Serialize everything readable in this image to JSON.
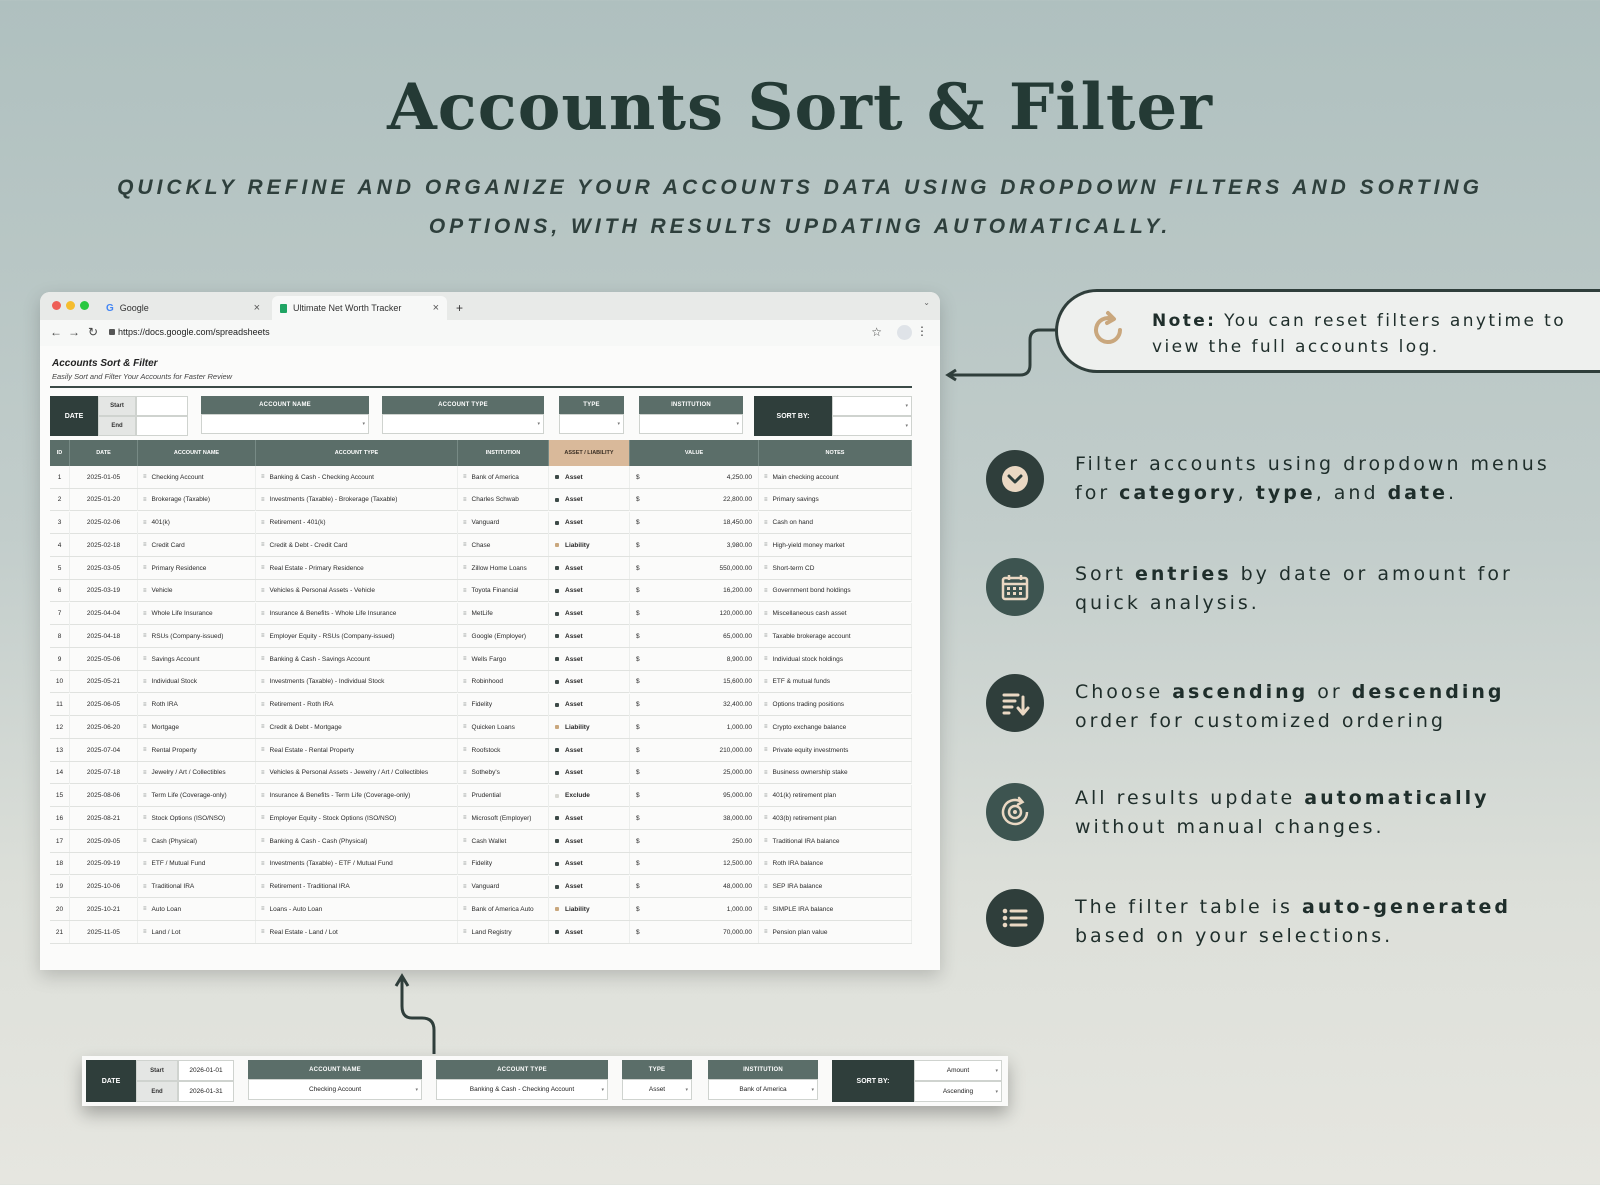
{
  "hero": {
    "title": "Accounts Sort & Filter",
    "subtitle_line1": "Quickly refine and organize your accounts data using dropdown filters and sorting",
    "subtitle_line2": "options, with results updating automatically."
  },
  "browser": {
    "tab1": "Google",
    "tab2": "Ultimate Net Worth Tracker",
    "new_tab": "+",
    "url": "https://docs.google.com/spreadsheets"
  },
  "sheet": {
    "title": "Accounts Sort & Filter",
    "subtitle": "Easily Sort and Filter Your Accounts for Faster Review"
  },
  "filters": {
    "date": "DATE",
    "start": "Start",
    "end": "End",
    "account_name": "ACCOUNT NAME",
    "account_type": "ACCOUNT TYPE",
    "type": "TYPE",
    "institution": "INSTITUTION",
    "sort_by": "SORT BY:"
  },
  "filters_example": {
    "start_value": "2026-01-01",
    "end_value": "2026-01-31",
    "account_name_value": "Checking Account",
    "account_type_value": "Banking & Cash - Checking Account",
    "type_value": "Asset",
    "institution_value": "Bank of America",
    "sort_value": "Amount",
    "order_value": "Ascending"
  },
  "table": {
    "headers": [
      "ID",
      "DATE",
      "ACCOUNT NAME",
      "ACCOUNT TYPE",
      "INSTITUTION",
      "ASSET / LIABILITY",
      "VALUE",
      "NOTES"
    ],
    "currency": "$",
    "rows": [
      [
        "1",
        "2025-01-05",
        "Checking Account",
        "Banking & Cash - Checking Account",
        "Bank of America",
        "Asset",
        "4,250.00",
        "Main checking account"
      ],
      [
        "2",
        "2025-01-20",
        "Brokerage (Taxable)",
        "Investments (Taxable) - Brokerage (Taxable)",
        "Charles Schwab",
        "Asset",
        "22,800.00",
        "Primary savings"
      ],
      [
        "3",
        "2025-02-06",
        "401(k)",
        "Retirement - 401(k)",
        "Vanguard",
        "Asset",
        "18,450.00",
        "Cash on hand"
      ],
      [
        "4",
        "2025-02-18",
        "Credit Card",
        "Credit & Debt - Credit Card",
        "Chase",
        "Liability",
        "3,980.00",
        "High-yield money market"
      ],
      [
        "5",
        "2025-03-05",
        "Primary Residence",
        "Real Estate - Primary Residence",
        "Zillow Home Loans",
        "Asset",
        "550,000.00",
        "Short-term CD"
      ],
      [
        "6",
        "2025-03-19",
        "Vehicle",
        "Vehicles & Personal Assets - Vehicle",
        "Toyota Financial",
        "Asset",
        "16,200.00",
        "Government bond holdings"
      ],
      [
        "7",
        "2025-04-04",
        "Whole Life Insurance",
        "Insurance & Benefits - Whole Life Insurance",
        "MetLife",
        "Asset",
        "120,000.00",
        "Miscellaneous cash asset"
      ],
      [
        "8",
        "2025-04-18",
        "RSUs (Company-issued)",
        "Employer Equity - RSUs (Company-issued)",
        "Google (Employer)",
        "Asset",
        "65,000.00",
        "Taxable brokerage account"
      ],
      [
        "9",
        "2025-05-06",
        "Savings Account",
        "Banking & Cash - Savings Account",
        "Wells Fargo",
        "Asset",
        "8,900.00",
        "Individual stock holdings"
      ],
      [
        "10",
        "2025-05-21",
        "Individual Stock",
        "Investments (Taxable) - Individual Stock",
        "Robinhood",
        "Asset",
        "15,600.00",
        "ETF & mutual funds"
      ],
      [
        "11",
        "2025-06-05",
        "Roth IRA",
        "Retirement - Roth IRA",
        "Fidelity",
        "Asset",
        "32,400.00",
        "Options trading positions"
      ],
      [
        "12",
        "2025-06-20",
        "Mortgage",
        "Credit & Debt - Mortgage",
        "Quicken Loans",
        "Liability",
        "1,000.00",
        "Crypto exchange balance"
      ],
      [
        "13",
        "2025-07-04",
        "Rental Property",
        "Real Estate - Rental Property",
        "Roofstock",
        "Asset",
        "210,000.00",
        "Private equity investments"
      ],
      [
        "14",
        "2025-07-18",
        "Jewelry / Art / Collectibles",
        "Vehicles & Personal Assets - Jewelry / Art / Collectibles",
        "Sotheby's",
        "Asset",
        "25,000.00",
        "Business ownership stake"
      ],
      [
        "15",
        "2025-08-06",
        "Term Life (Coverage-only)",
        "Insurance & Benefits - Term Life (Coverage-only)",
        "Prudential",
        "Exclude",
        "95,000.00",
        "401(k) retirement plan"
      ],
      [
        "16",
        "2025-08-21",
        "Stock Options (ISO/NSO)",
        "Employer Equity - Stock Options (ISO/NSO)",
        "Microsoft (Employer)",
        "Asset",
        "38,000.00",
        "403(b) retirement plan"
      ],
      [
        "17",
        "2025-09-05",
        "Cash (Physical)",
        "Banking & Cash - Cash (Physical)",
        "Cash Wallet",
        "Asset",
        "250.00",
        "Traditional IRA balance"
      ],
      [
        "18",
        "2025-09-19",
        "ETF / Mutual Fund",
        "Investments (Taxable) - ETF / Mutual Fund",
        "Fidelity",
        "Asset",
        "12,500.00",
        "Roth IRA balance"
      ],
      [
        "19",
        "2025-10-06",
        "Traditional IRA",
        "Retirement - Traditional IRA",
        "Vanguard",
        "Asset",
        "48,000.00",
        "SEP IRA balance"
      ],
      [
        "20",
        "2025-10-21",
        "Auto Loan",
        "Loans - Auto Loan",
        "Bank of America Auto",
        "Liability",
        "1,000.00",
        "SIMPLE IRA balance"
      ],
      [
        "21",
        "2025-11-05",
        "Land / Lot",
        "Real Estate - Land / Lot",
        "Land Registry",
        "Asset",
        "70,000.00",
        "Pension plan value"
      ]
    ]
  },
  "colors": {
    "asset": "#3d4a47",
    "liability": "#c9a77d",
    "exclude": "#d8d8d2",
    "header": "#5b6e69",
    "dark": "#2f3e3b",
    "highlight": "#d9b99a"
  },
  "note": {
    "bold": "Note:",
    "text": " You can reset filters anytime to view the full accounts log.",
    "icon": "reset-icon"
  },
  "features": [
    {
      "icon": "chevron-down-icon",
      "p1": "Filter accounts using dropdown menus for ",
      "b1": "category",
      "p2": ", ",
      "b2": "type",
      "p3": ", and ",
      "b3": "date",
      "p4": "."
    },
    {
      "icon": "calendar-icon",
      "p1": "Sort ",
      "b1": "entries",
      "p2": " by date or amount for quick analysis.",
      "b2": "",
      "p3": "",
      "b3": "",
      "p4": ""
    },
    {
      "icon": "sort-icon",
      "p1": "Choose ",
      "b1": "ascending",
      "p2": " or ",
      "b2": "descending",
      "p3": " order for customized ordering",
      "b3": "",
      "p4": ""
    },
    {
      "icon": "gear-refresh-icon",
      "p1": "All results update ",
      "b1": "automatically",
      "p2": " without manual changes.",
      "b2": "",
      "p3": "",
      "b3": "",
      "p4": ""
    },
    {
      "icon": "list-icon",
      "p1": "The filter table is ",
      "b1": "auto-generated",
      "p2": " based on your selections.",
      "b2": "",
      "p3": "",
      "b3": "",
      "p4": ""
    }
  ]
}
